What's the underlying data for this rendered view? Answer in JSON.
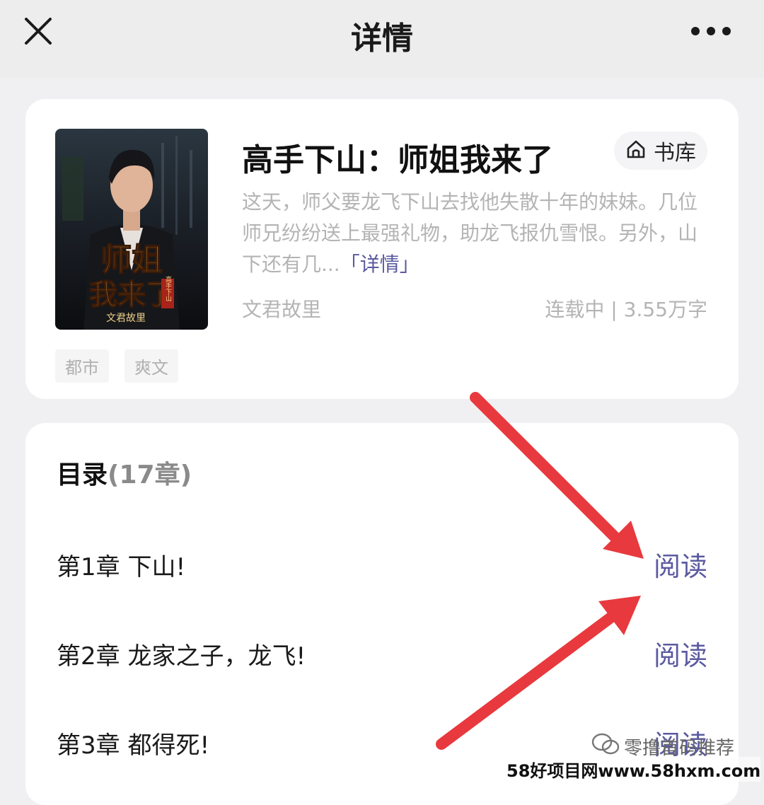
{
  "navbar": {
    "title": "详情",
    "close_icon": "close-icon",
    "more_icon": "more-dots-icon"
  },
  "book": {
    "title": "高手下山：师姐我来了",
    "library_label": "书库",
    "library_icon": "home-icon",
    "description": "这天，师父要龙飞下山去找他失散十年的妹妹。几位师兄纷纷送上最强礼物，助龙飞报仇雪恨。另外，山下还有几...",
    "description_more": "「详情」",
    "author": "文君故里",
    "status": "连载中 | 3.55万字",
    "tags": [
      "都市",
      "爽文"
    ],
    "cover": {
      "title_line1": "师姐",
      "title_line2": "我来了",
      "subtitle": "高手下山",
      "author": "文君故里"
    }
  },
  "toc": {
    "title": "目录",
    "count": "(17章)",
    "chapters": [
      {
        "title": "第1章 下山!",
        "action": "阅读"
      },
      {
        "title": "第2章 龙家之子，龙飞!",
        "action": "阅读"
      },
      {
        "title": "第3章 都得死!",
        "action": "阅读"
      }
    ]
  },
  "watermark": {
    "wechat": "零撸首码推荐",
    "site": "58好项目网www.58hxm.com"
  },
  "colors": {
    "accent": "#5b5aa0",
    "annotation_arrow": "#e8393e",
    "page_bg": "#f0f0f2"
  }
}
